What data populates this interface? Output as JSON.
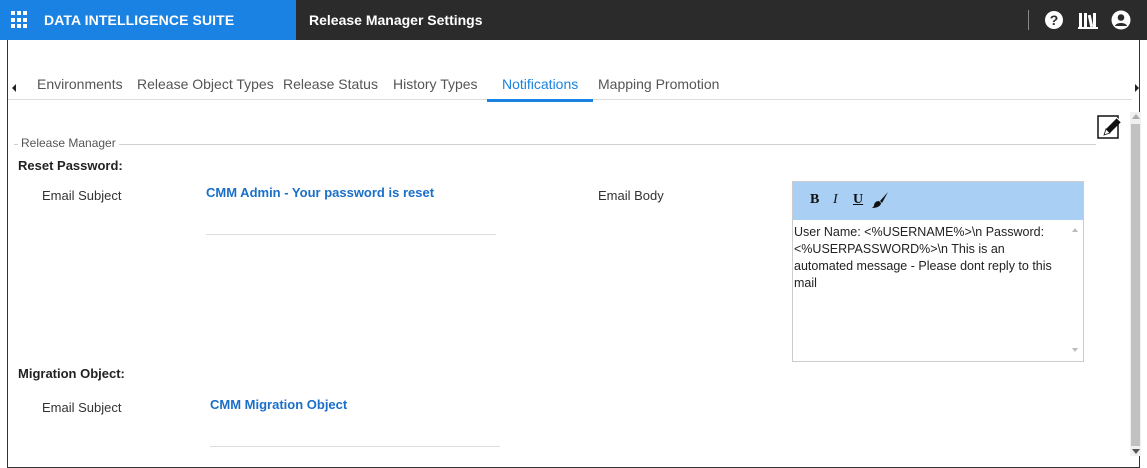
{
  "header": {
    "brand": "DATA INTELLIGENCE SUITE",
    "app_title": "Release Manager Settings",
    "icons": [
      "apps-grid-icon",
      "help-icon",
      "library-icon",
      "user-icon"
    ],
    "brand_color": "#1a82e2",
    "bar_color": "#2b2b2b"
  },
  "tabs": [
    {
      "label": "Environments",
      "active": false
    },
    {
      "label": "Release Object Types",
      "active": false
    },
    {
      "label": "Release Status",
      "active": false
    },
    {
      "label": "History Types",
      "active": false
    },
    {
      "label": "Notifications",
      "active": true
    },
    {
      "label": "Mapping Promotion",
      "active": false
    }
  ],
  "group": {
    "legend": "Release Manager"
  },
  "reset_password": {
    "heading": "Reset Password:",
    "subject_label": "Email Subject",
    "subject_value": "CMM Admin - Your password is reset",
    "body_label": "Email Body",
    "body_text": "User Name: <%USERNAME%>\\n Password: <%USERPASSWORD%>\\n This is an automated message - Please dont reply to this mail"
  },
  "editor_toolbar": {
    "bold": "B",
    "italic": "I",
    "underline": "U",
    "toolbar_color": "#a9cff5"
  },
  "migration_object": {
    "heading": "Migration Object:",
    "subject_label": "Email Subject",
    "subject_value": "CMM Migration Object"
  }
}
